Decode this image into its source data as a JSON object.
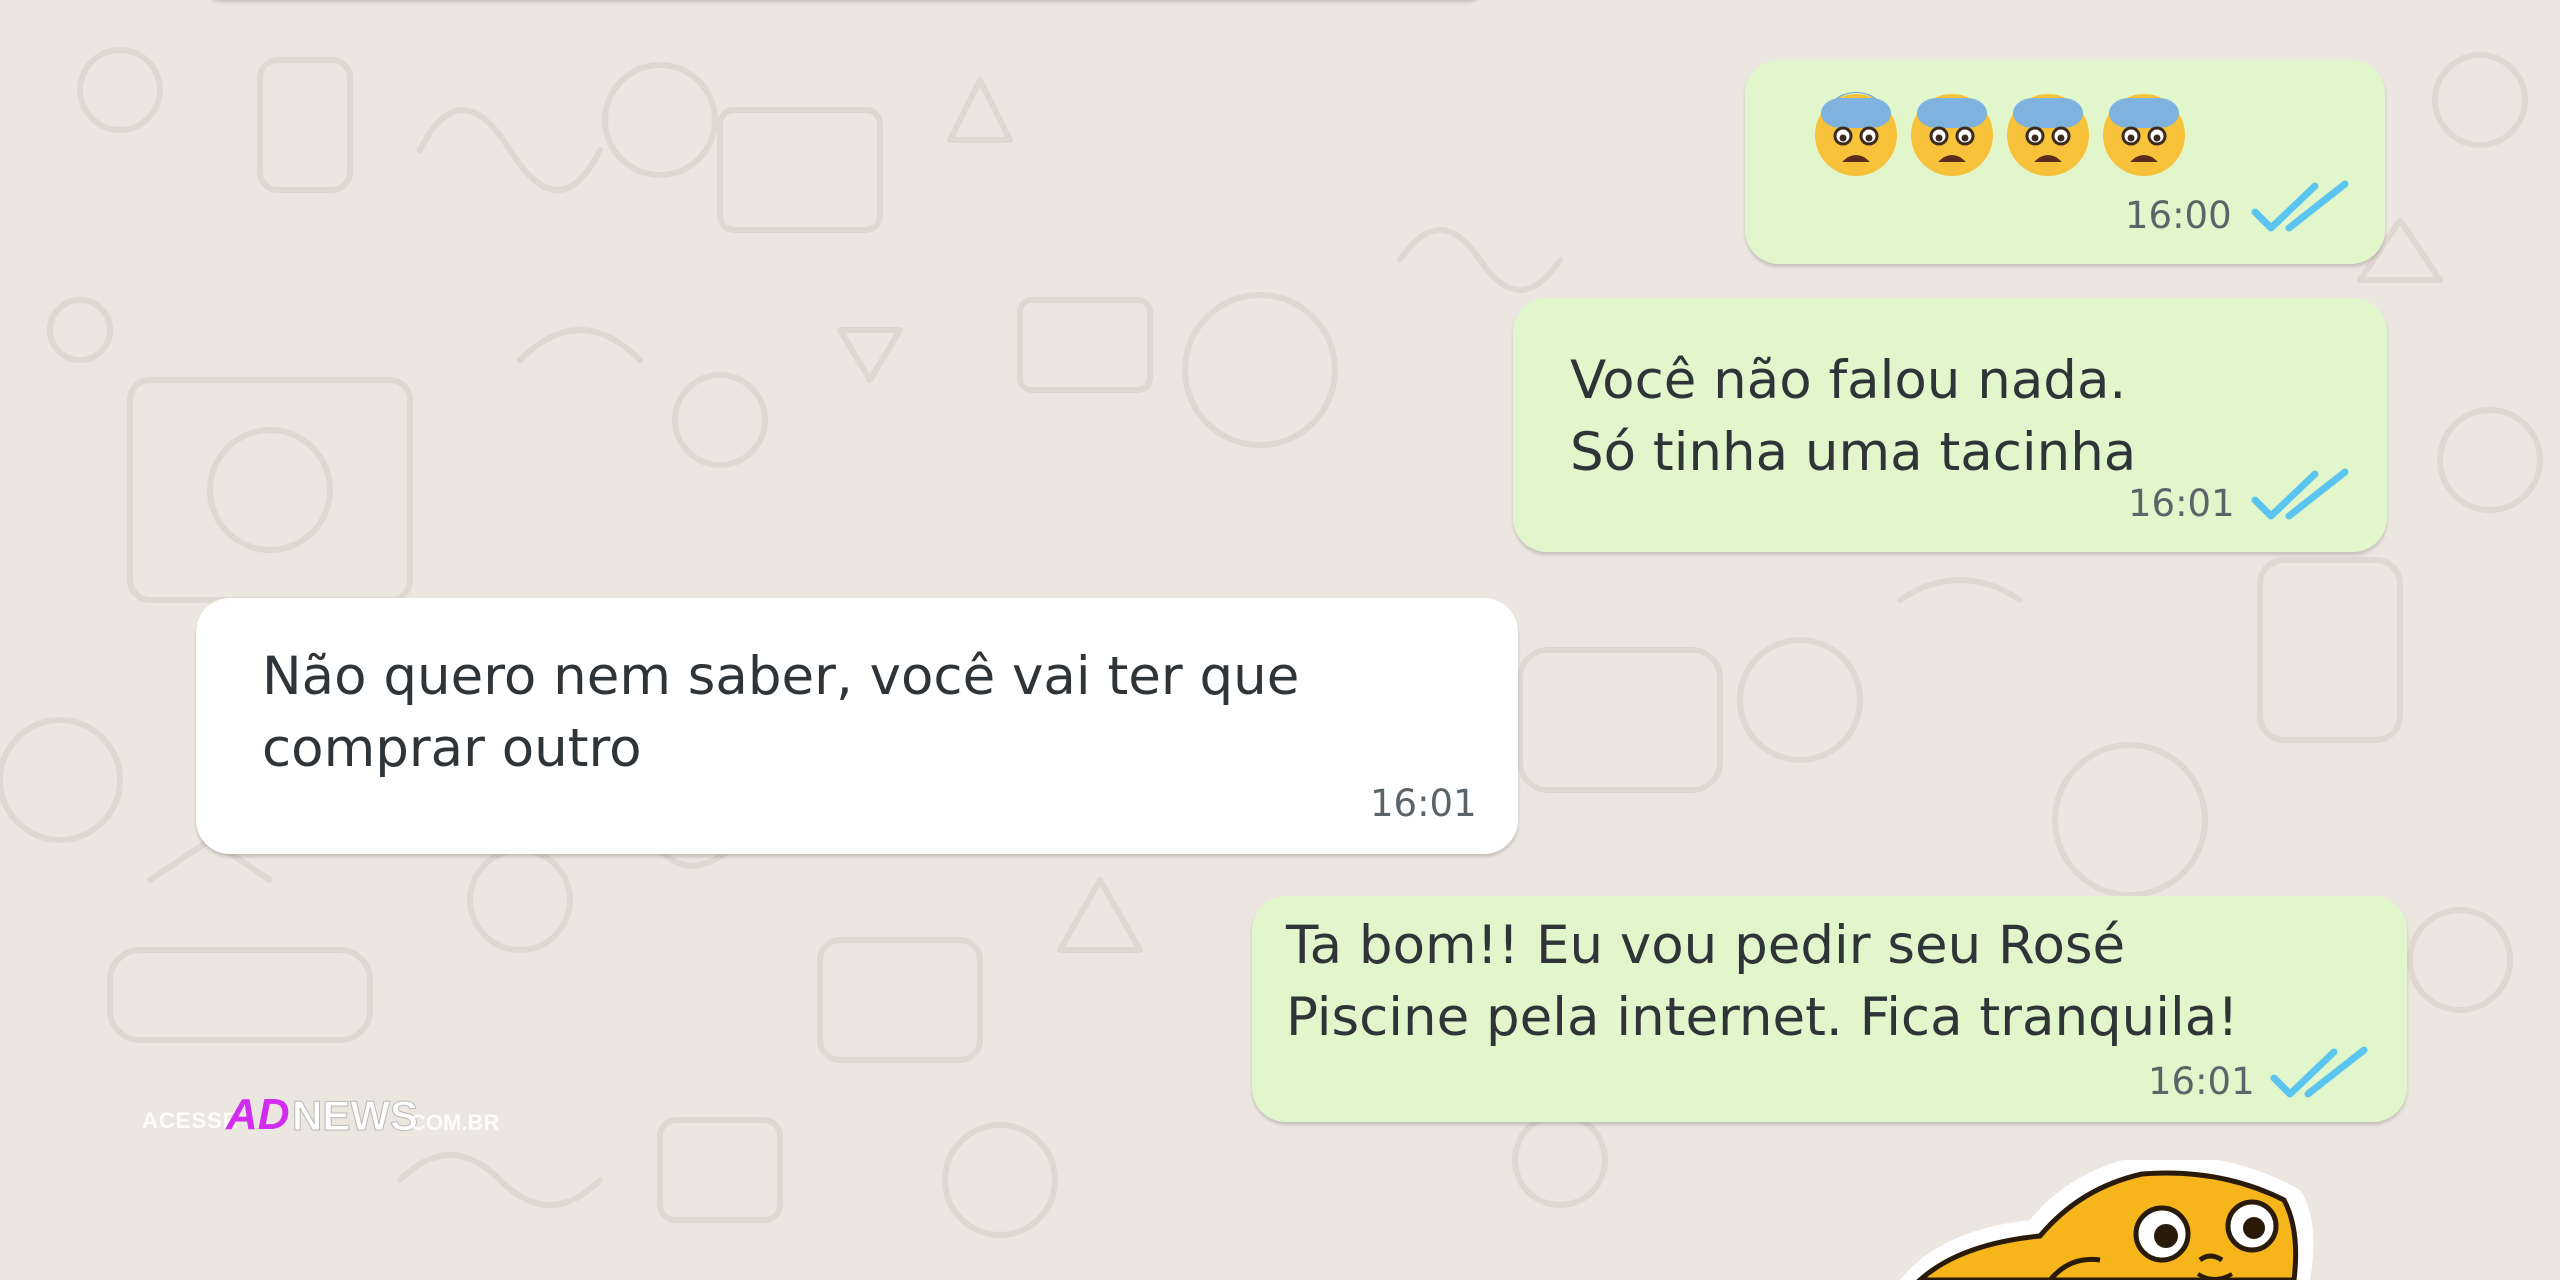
{
  "chat": {
    "messages": [
      {
        "direction": "outgoing",
        "emoji": [
          "fearful-face",
          "fearful-face",
          "fearful-face",
          "fearful-face"
        ],
        "time": "16:00",
        "status": "read"
      },
      {
        "direction": "outgoing",
        "text": "Você não falou nada.\nSó tinha uma tacinha",
        "time": "16:01",
        "status": "read"
      },
      {
        "direction": "incoming",
        "text": "Não quero nem saber, você vai ter que\ncomprar outro",
        "time": "16:01"
      },
      {
        "direction": "outgoing",
        "text": "Ta bom!! Eu vou pedir seu Rosé\nPiscine pela internet. Fica tranquila!",
        "time": "16:01",
        "status": "read"
      }
    ]
  },
  "watermark": {
    "prefix": "ACESSE",
    "brand": "AD",
    "brand_suffix": "NEWS",
    "suffix": ".COM.BR"
  },
  "sticker": "jake-the-dog-sticker",
  "colors": {
    "background": "#ece6e0",
    "outgoing_bubble": "#e1f7cb",
    "incoming_bubble": "#ffffff",
    "read_ticks": "#5bc4f0",
    "watermark_brand": "#d12cf0"
  }
}
